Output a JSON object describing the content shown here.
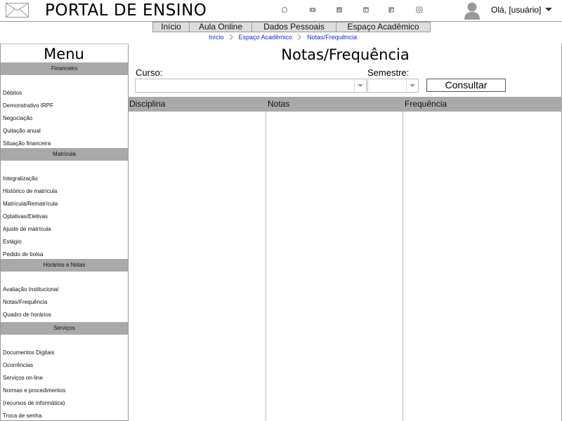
{
  "header": {
    "site_title": "PORTAL DE ENSINO",
    "greeting": "Olá, [usuário]",
    "social_icons": [
      "whatsapp-icon",
      "youtube-icon",
      "twitter-icon",
      "linkedin-icon",
      "facebook-icon",
      "instagram-icon"
    ]
  },
  "nav": {
    "items": [
      "Início",
      "Aula Online",
      "Dados Pessoais",
      "Espaço Acadêmico"
    ]
  },
  "breadcrumb": [
    "Início",
    "Espaço Acadêmico",
    "Notas/Frequência"
  ],
  "sidebar": {
    "title": "Menu",
    "sections": [
      {
        "heading": "Financeiro",
        "items": [
          "Débitos",
          "Demonstrativo IRPF",
          "Negociação",
          "Quitação anual",
          "Situação financeira"
        ]
      },
      {
        "heading": "Matrícula",
        "items": [
          "Integralização",
          "Histórico de matrícula",
          "Matrícula/Rematrícula",
          "Optativas/Eletivas",
          "Ajuste de matrícula",
          "Estágio",
          "Pedido de bolsa"
        ]
      },
      {
        "heading": "Horários e Notas",
        "items": [
          "Avaliação Institucional",
          "Notas/Frequência",
          "Quadro de horários"
        ]
      },
      {
        "heading": "Serviços",
        "items": [
          "Documentos Digitais",
          "Ocorrências",
          "Serviços on-line",
          "Normas e procedimentos",
          "(recursos de informática)",
          "Troca de senha"
        ]
      }
    ]
  },
  "main": {
    "title": "Notas/Frequência",
    "curso_label": "Curso:",
    "curso_value": "",
    "semestre_label": "Semestre:",
    "semestre_value": "",
    "consultar_label": "Consultar",
    "columns": [
      "Disciplina",
      "Notas",
      "Frequência"
    ]
  }
}
